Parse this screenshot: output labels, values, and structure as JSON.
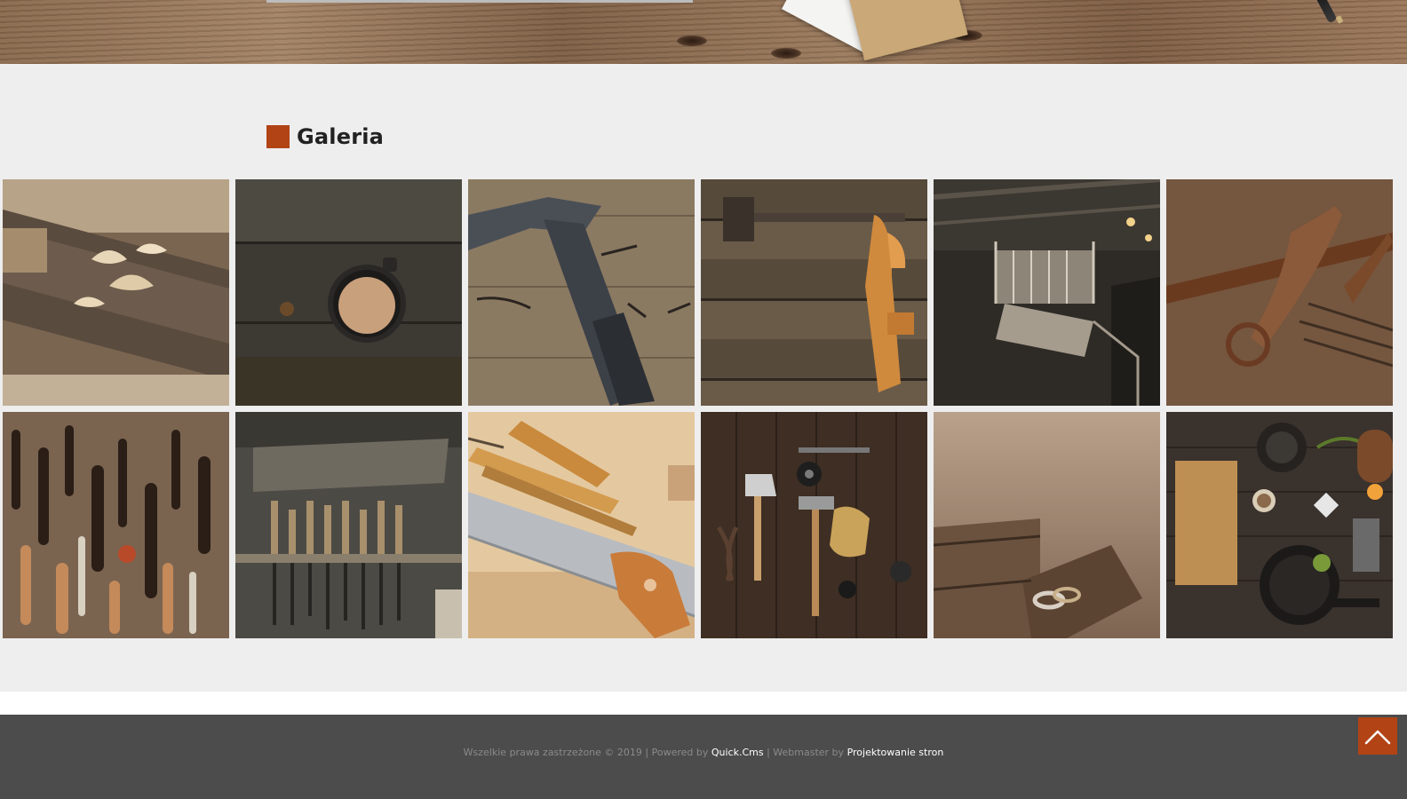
{
  "gallery": {
    "title": "Galeria",
    "accent_color": "#b14315",
    "images": [
      {
        "subject": "wood-shavings-on-plank"
      },
      {
        "subject": "coffee-mug-on-dark-wood"
      },
      {
        "subject": "hammer-and-nails"
      },
      {
        "subject": "hand-plane-on-boards"
      },
      {
        "subject": "wooden-staircase-interior"
      },
      {
        "subject": "pincers-and-nails"
      },
      {
        "subject": "tool-pegboard"
      },
      {
        "subject": "chisels-on-shelf"
      },
      {
        "subject": "chisels-and-saw"
      },
      {
        "subject": "tool-flat-lay"
      },
      {
        "subject": "rings-on-wood"
      },
      {
        "subject": "kitchen-still-life"
      }
    ]
  },
  "footer": {
    "rights_text": "Wszelkie prawa zastrzeżone © 2019 | Powered by ",
    "cms_link": "Quick.Cms",
    "webmaster_text": " | Webmaster by ",
    "webmaster_link": "Projektowanie stron",
    "background_color": "#4c4c4c",
    "back_to_top_icon": "chevron-up-icon"
  }
}
